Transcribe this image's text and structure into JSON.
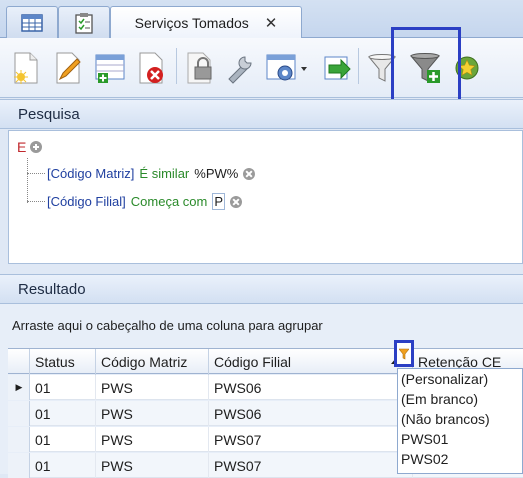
{
  "tabs": [
    {
      "label": "",
      "icon": "grid-icon"
    },
    {
      "label": "",
      "icon": "checklist-icon"
    },
    {
      "label": "Serviços Tomados",
      "icon": "",
      "active": true
    }
  ],
  "tab_close_glyph": "✕",
  "toolbar": {
    "buttons": [
      "new-document-icon",
      "edit-pencil-icon",
      "add-record-icon",
      "delete-icon",
      "lock-icon",
      "tools-icon",
      "settings-dropdown-icon",
      "export-icon",
      "filter-icon",
      "filter-add-icon",
      "favorite-star-icon"
    ]
  },
  "search": {
    "title": "Pesquisa",
    "root_operator": "E",
    "conditions": [
      {
        "field": "[Código Matriz]",
        "operator": "É similar",
        "value": "%PW%"
      },
      {
        "field": "[Código Filial]",
        "operator": "Começa com",
        "value": "P"
      }
    ]
  },
  "result": {
    "title": "Resultado",
    "group_hint": "Arraste aqui o cabeçalho de uma coluna para agrupar",
    "columns": [
      "Status",
      "Código Matriz",
      "Código Filial",
      "Retenção CE"
    ],
    "rows": [
      {
        "status": "01",
        "matriz": "PWS",
        "filial": "PWS06"
      },
      {
        "status": "01",
        "matriz": "PWS",
        "filial": "PWS06"
      },
      {
        "status": "01",
        "matriz": "PWS",
        "filial": "PWS07"
      },
      {
        "status": "01",
        "matriz": "PWS",
        "filial": "PWS07"
      }
    ]
  },
  "filter_dropdown": {
    "items": [
      "(Personalizar)",
      "(Em branco)",
      "(Não brancos)",
      "PWS01",
      "PWS02"
    ]
  },
  "colors": {
    "highlight": "#2b3fc4",
    "root_operator": "#c0282d",
    "field": "#2040a0",
    "operator": "#2a8a2a"
  }
}
